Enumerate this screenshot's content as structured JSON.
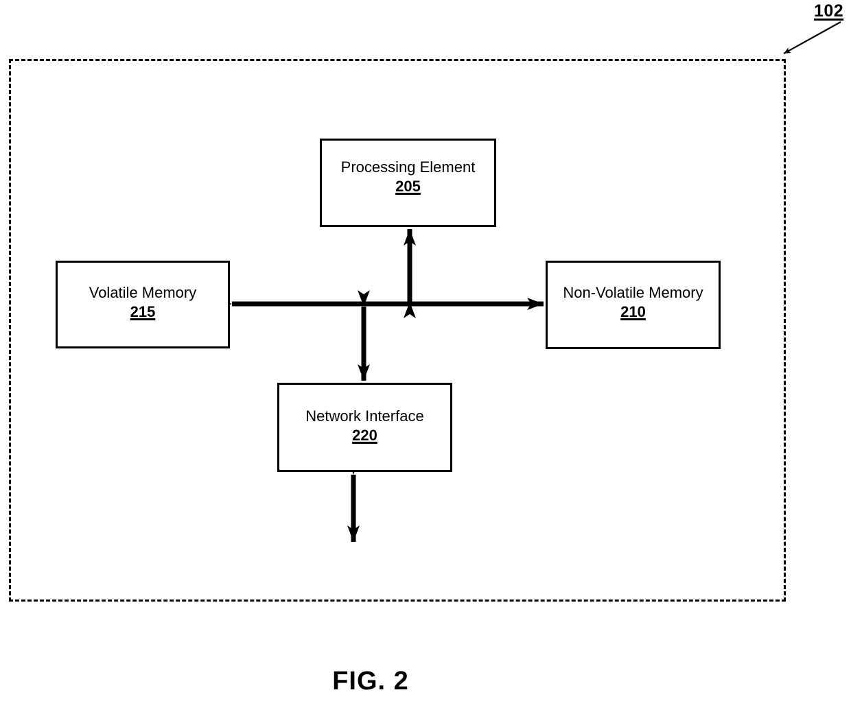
{
  "figure": {
    "caption": "FIG. 2",
    "system_reference": "102"
  },
  "components": [
    {
      "id": "processing-element",
      "title": "Processing Element",
      "reference": "205"
    },
    {
      "id": "volatile-memory",
      "title": "Volatile Memory",
      "reference": "215"
    },
    {
      "id": "non-volatile-memory",
      "title": "Non-Volatile Memory",
      "reference": "210"
    },
    {
      "id": "network-interface",
      "title": "Network Interface",
      "reference": "220"
    }
  ],
  "connections": [
    {
      "name": "bus-horizontal",
      "from": "volatile-memory",
      "to": "non-volatile-memory",
      "style": "double-arrow"
    },
    {
      "name": "bus-to-processing-element",
      "from": "bus",
      "to": "processing-element",
      "style": "double-arrow"
    },
    {
      "name": "bus-to-network-interface",
      "from": "bus",
      "to": "network-interface",
      "style": "double-arrow"
    },
    {
      "name": "network-interface-external",
      "from": "network-interface",
      "to": "external",
      "style": "double-arrow"
    }
  ],
  "colors": {
    "stroke": "#000000",
    "background": "#ffffff"
  }
}
